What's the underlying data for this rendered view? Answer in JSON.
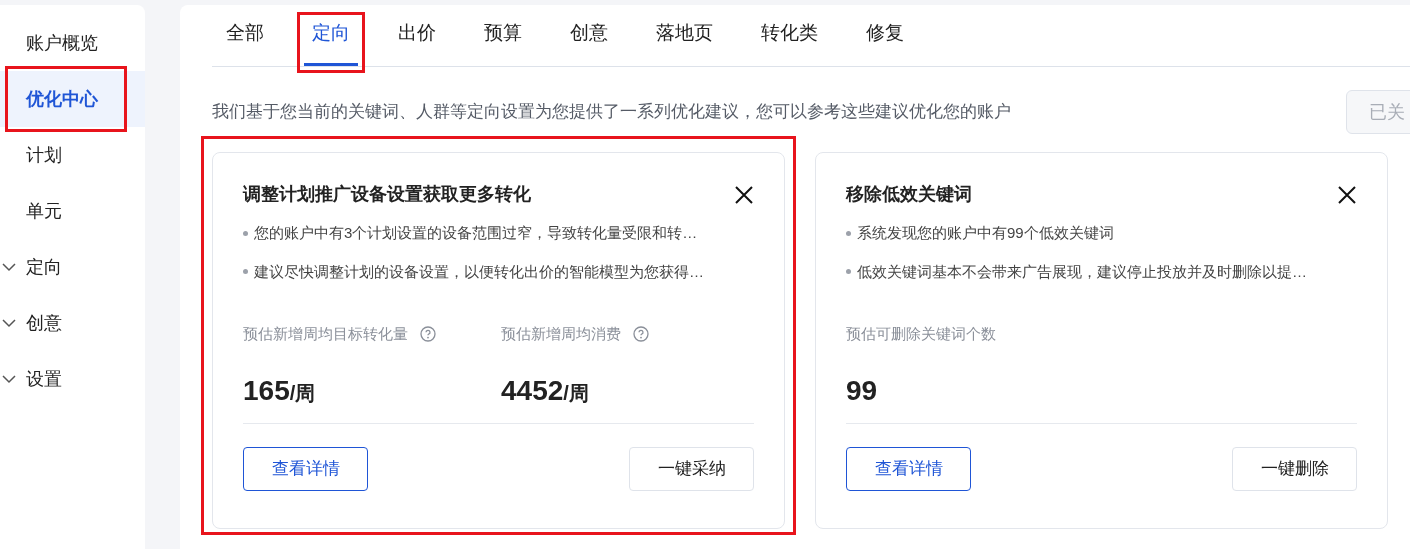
{
  "sidebar": {
    "items": [
      {
        "label": "账户概览",
        "kind": "link",
        "selected": false,
        "highlighted": false
      },
      {
        "label": "优化中心",
        "kind": "link",
        "selected": true,
        "highlighted": true
      },
      {
        "label": "计划",
        "kind": "link",
        "selected": false,
        "highlighted": false
      },
      {
        "label": "单元",
        "kind": "link",
        "selected": false,
        "highlighted": false
      },
      {
        "label": "定向",
        "kind": "group",
        "selected": false,
        "highlighted": false
      },
      {
        "label": "创意",
        "kind": "group",
        "selected": false,
        "highlighted": false
      },
      {
        "label": "设置",
        "kind": "group",
        "selected": false,
        "highlighted": false
      }
    ]
  },
  "tabs": [
    {
      "label": "全部",
      "selected": false,
      "highlighted": false
    },
    {
      "label": "定向",
      "selected": true,
      "highlighted": true
    },
    {
      "label": "出价",
      "selected": false,
      "highlighted": false
    },
    {
      "label": "预算",
      "selected": false,
      "highlighted": false
    },
    {
      "label": "创意",
      "selected": false,
      "highlighted": false
    },
    {
      "label": "落地页",
      "selected": false,
      "highlighted": false
    },
    {
      "label": "转化类",
      "selected": false,
      "highlighted": false
    },
    {
      "label": "修复",
      "selected": false,
      "highlighted": false
    }
  ],
  "description": "我们基于您当前的关键词、人群等定向设置为您提供了一系列优化建议，您可以参考这些建议优化您的账户",
  "closed_button": "已关",
  "cards": [
    {
      "title": "调整计划推广设备设置获取更多转化",
      "highlighted": true,
      "bullets": [
        "您的账户中有3个计划设置的设备范围过窄，导致转化量受限和转…",
        "建议尽快调整计划的设备设置，以便转化出价的智能模型为您获得…"
      ],
      "metrics": [
        {
          "label": "预估新增周均目标转化量",
          "help": true,
          "value": "165",
          "unit": "/周"
        },
        {
          "label": "预估新增周均消费",
          "help": true,
          "value": "4452",
          "unit": "/周"
        }
      ],
      "primary": "查看详情",
      "secondary": "一键采纳"
    },
    {
      "title": "移除低效关键词",
      "highlighted": false,
      "bullets": [
        "系统发现您的账户中有99个低效关键词",
        "低效关键词基本不会带来广告展现，建议停止投放并及时删除以提…"
      ],
      "metrics": [
        {
          "label": "预估可删除关键词个数",
          "help": false,
          "value": "99"
        }
      ],
      "primary": "查看详情",
      "secondary": "一键删除"
    }
  ]
}
